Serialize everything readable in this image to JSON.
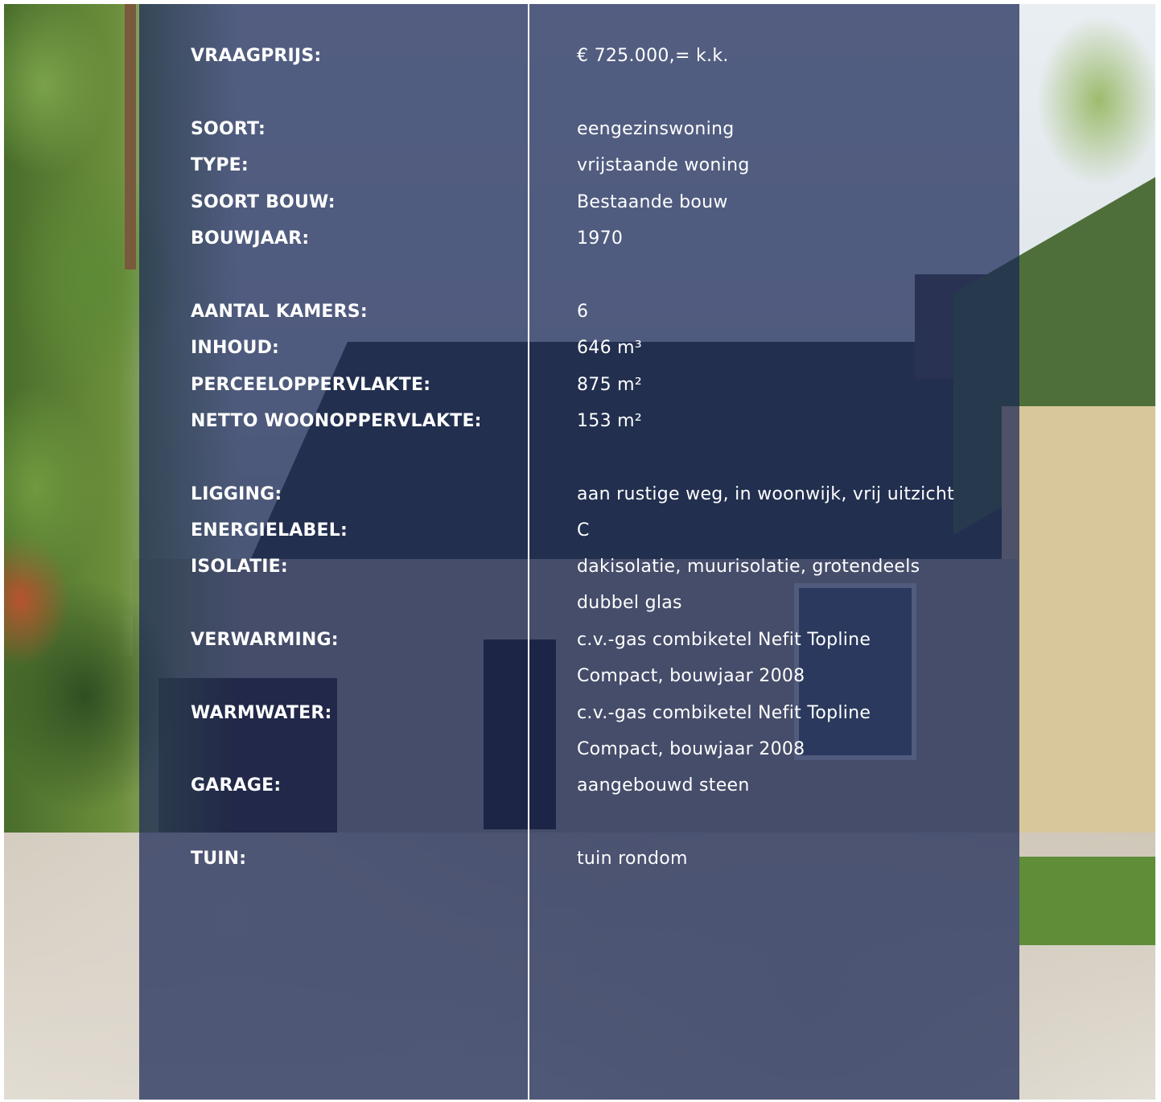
{
  "overlay_color": "#172554",
  "rows": [
    {
      "label": "VRAAGPRIJS:",
      "value": "€ 725.000,= k.k.",
      "value2": ""
    },
    {
      "label": "SOORT:",
      "value": "eengezinswoning",
      "value2": ""
    },
    {
      "label": "TYPE:",
      "value": "vrijstaande woning",
      "value2": ""
    },
    {
      "label": "SOORT BOUW:",
      "value": "Bestaande bouw",
      "value2": ""
    },
    {
      "label": "BOUWJAAR:",
      "value": "1970",
      "value2": ""
    },
    {
      "label": "AANTAL KAMERS:",
      "value": "6",
      "value2": ""
    },
    {
      "label": "INHOUD:",
      "value": "646 m³",
      "value2": ""
    },
    {
      "label": "PERCEELOPPERVLAKTE:",
      "value": "875 m²",
      "value2": ""
    },
    {
      "label": "NETTO WOONOPPERVLAKTE:",
      "value": "153 m²",
      "value2": ""
    },
    {
      "label": "LIGGING:",
      "value": "aan rustige weg, in woonwijk, vrij uitzicht",
      "value2": ""
    },
    {
      "label": "ENERGIELABEL:",
      "value": "C",
      "value2": ""
    },
    {
      "label": "ISOLATIE:",
      "value": "dakisolatie, muurisolatie, grotendeels",
      "value2": "dubbel glas"
    },
    {
      "label": "VERWARMING:",
      "value": "c.v.-gas combiketel Nefit Topline",
      "value2": "Compact, bouwjaar 2008"
    },
    {
      "label": "WARMWATER:",
      "value": "c.v.-gas combiketel Nefit Topline",
      "value2": "Compact, bouwjaar 2008"
    },
    {
      "label": "GARAGE:",
      "value": "aangebouwd steen",
      "value2": ""
    },
    {
      "label": "TUIN:",
      "value": "tuin rondom",
      "value2": ""
    }
  ]
}
